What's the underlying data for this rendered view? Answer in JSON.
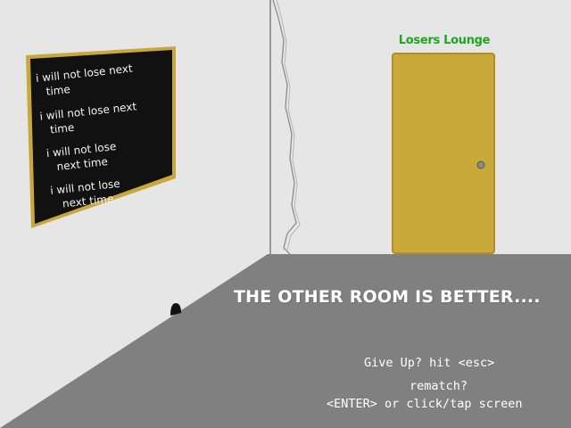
{
  "scene": {
    "door_sign": "Losers Lounge",
    "headline": "THE OTHER ROOM IS BETTER....",
    "prompts": {
      "give_up": "Give Up? hit <esc>",
      "rematch": "rematch?",
      "enter": "<ENTER> or click/tap screen"
    },
    "chalkboard_lines": [
      "i will not lose next",
      "time",
      "i will not lose next",
      "time",
      "i will not lose",
      "next time",
      "i will not lose",
      "next time..."
    ]
  },
  "colors": {
    "wall": "#e6e6e6",
    "floor": "#7f7f7f",
    "door": "#c9a93a",
    "door_border": "#b08f24",
    "door_sign": "#1ea51e",
    "board": "#111111",
    "board_frame": "#c8a83a",
    "chalk": "#f2f2f2",
    "text": "#ffffff"
  }
}
